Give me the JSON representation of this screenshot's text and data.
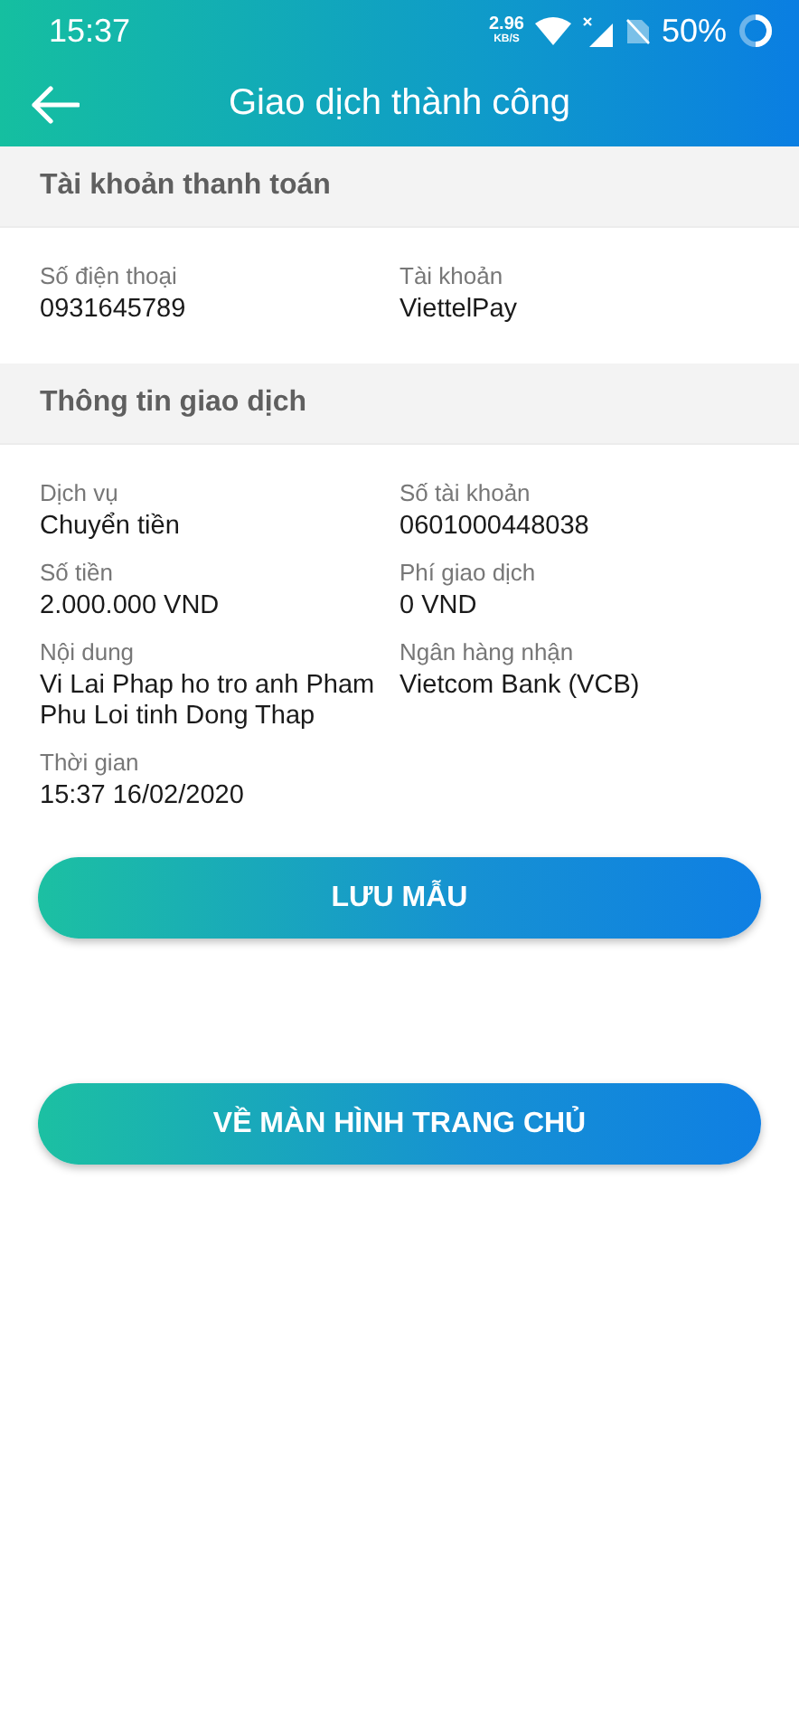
{
  "status_bar": {
    "time": "15:37",
    "net_speed": {
      "value": "2.96",
      "unit": "KB/S"
    },
    "battery": "50%"
  },
  "header": {
    "title": "Giao dịch thành công"
  },
  "sections": [
    {
      "title": "Tài khoản thanh toán",
      "fields": [
        {
          "label": "Số điện thoại",
          "value": "0931645789"
        },
        {
          "label": "Tài khoản",
          "value": "ViettelPay"
        }
      ]
    },
    {
      "title": "Thông tin giao dịch",
      "fields": [
        {
          "label": "Dịch vụ",
          "value": "Chuyển tiền"
        },
        {
          "label": "Số tài khoản",
          "value": "0601000448038"
        },
        {
          "label": "Số tiền",
          "value": "2.000.000 VND"
        },
        {
          "label": "Phí giao dịch",
          "value": "0 VND"
        },
        {
          "label": "Nội dung",
          "value": "Vi Lai Phap ho tro anh Pham Phu Loi tinh Dong Thap"
        },
        {
          "label": "Ngân hàng nhận",
          "value": "Vietcom Bank (VCB)"
        },
        {
          "label": "Thời gian",
          "value": "15:37 16/02/2020"
        }
      ]
    }
  ],
  "buttons": [
    {
      "label": "LƯU MẪU"
    },
    {
      "label": "VỀ MÀN HÌNH TRANG CHỦ"
    }
  ]
}
